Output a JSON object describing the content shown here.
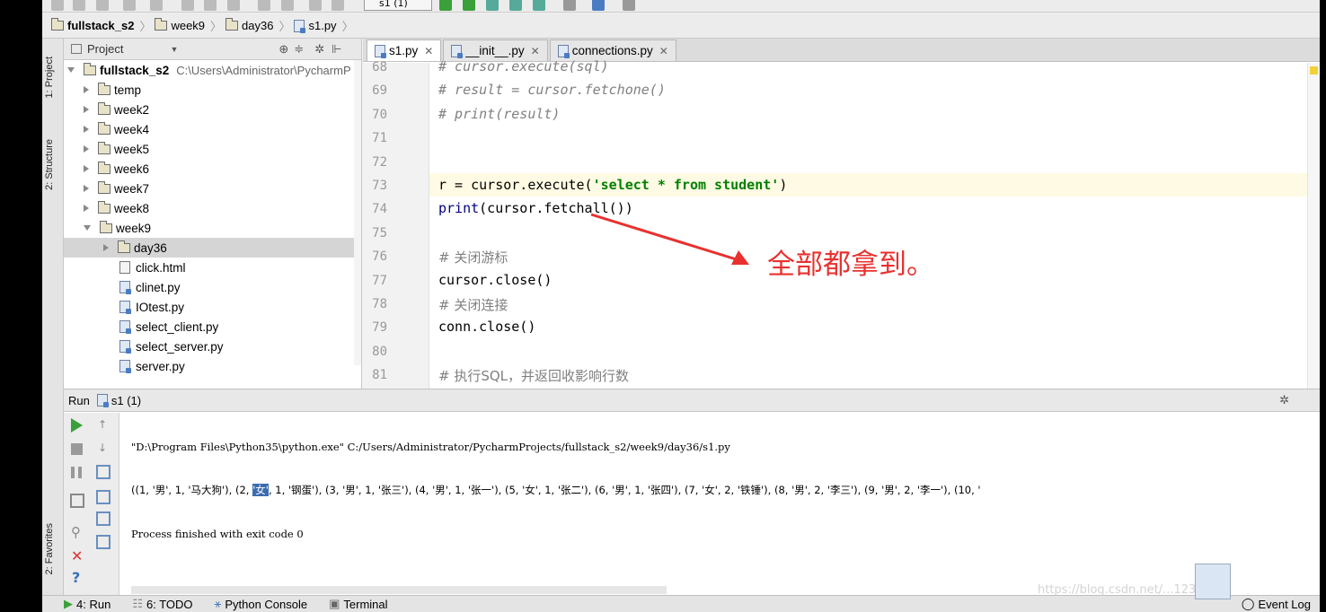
{
  "breadcrumbs": [
    "fullstack_s2",
    "week9",
    "day36",
    "s1.py"
  ],
  "run_config": "s1 (1)",
  "project_panel": {
    "title": "Project",
    "root_name": "fullstack_s2",
    "root_path": "C:\\Users\\Administrator\\PycharmP",
    "items": [
      {
        "label": "temp",
        "type": "folder"
      },
      {
        "label": "week2",
        "type": "folder"
      },
      {
        "label": "week4",
        "type": "folder"
      },
      {
        "label": "week5",
        "type": "folder"
      },
      {
        "label": "week6",
        "type": "folder"
      },
      {
        "label": "week7",
        "type": "folder"
      },
      {
        "label": "week8",
        "type": "folder"
      },
      {
        "label": "week9",
        "type": "folder-open"
      },
      {
        "label": "day36",
        "type": "folder-selected"
      },
      {
        "label": "click.html",
        "type": "html"
      },
      {
        "label": "clinet.py",
        "type": "py"
      },
      {
        "label": "IOtest.py",
        "type": "py"
      },
      {
        "label": "select_client.py",
        "type": "py"
      },
      {
        "label": "select_server.py",
        "type": "py"
      },
      {
        "label": "server.py",
        "type": "py"
      }
    ]
  },
  "side_tabs": {
    "project": "1: Project",
    "structure": "2: Structure",
    "favorites": "2: Favorites"
  },
  "editor_tabs": [
    {
      "label": "s1.py",
      "active": true
    },
    {
      "label": "__init__.py",
      "active": false
    },
    {
      "label": "connections.py",
      "active": false
    }
  ],
  "code_lines": [
    {
      "num": "68",
      "text": "# cursor.execute(sql)"
    },
    {
      "num": "69",
      "text": "# result = cursor.fetchone()"
    },
    {
      "num": "70",
      "text": "# print(result)"
    },
    {
      "num": "71",
      "text": ""
    },
    {
      "num": "72",
      "text": ""
    },
    {
      "num": "73",
      "pre": "r = cursor.execute(",
      "str": "'select * from student'",
      "post": ")"
    },
    {
      "num": "74",
      "pre": "print",
      "post": "(cursor.fetchall())"
    },
    {
      "num": "75",
      "text": ""
    },
    {
      "num": "76",
      "text": "# 关闭游标"
    },
    {
      "num": "77",
      "text": "cursor.close()"
    },
    {
      "num": "78",
      "text": "# 关闭连接"
    },
    {
      "num": "79",
      "text": "conn.close()"
    },
    {
      "num": "80",
      "text": ""
    },
    {
      "num": "81",
      "text": "# 执行SQL，并返回收影响行数"
    }
  ],
  "annotation": "全部都拿到。",
  "run_panel": {
    "label": "Run",
    "config": "s1 (1)",
    "cmd": "\"D:\\Program Files\\Python35\\python.exe\" C:/Users/Administrator/PycharmProjects/fullstack_s2/week9/day36/s1.py",
    "output_a": "((1, '男', 1, '马大狗'), (2, ",
    "output_hl": "'女'",
    "output_b": ", 1, '钢蛋'), (3, '男', 1, '张三'), (4, '男', 1, '张一'), (5, '女', 1, '张二'), (6, '男', 1, '张四'), (7, '女', 2, '铁锤'), (8, '男', 2, '李三'), (9, '男', 2, '李一'), (10, '",
    "exit": "Process finished with exit code 0"
  },
  "bottom_tabs": [
    "4: Run",
    "6: TODO",
    "Python Console",
    "Terminal"
  ],
  "event_log": "Event Log",
  "watermark": "https://blog.csdn.net/...1231...",
  "colors": {
    "accent_red": "#e8312f",
    "comment": "#808080",
    "string": "#008000"
  }
}
